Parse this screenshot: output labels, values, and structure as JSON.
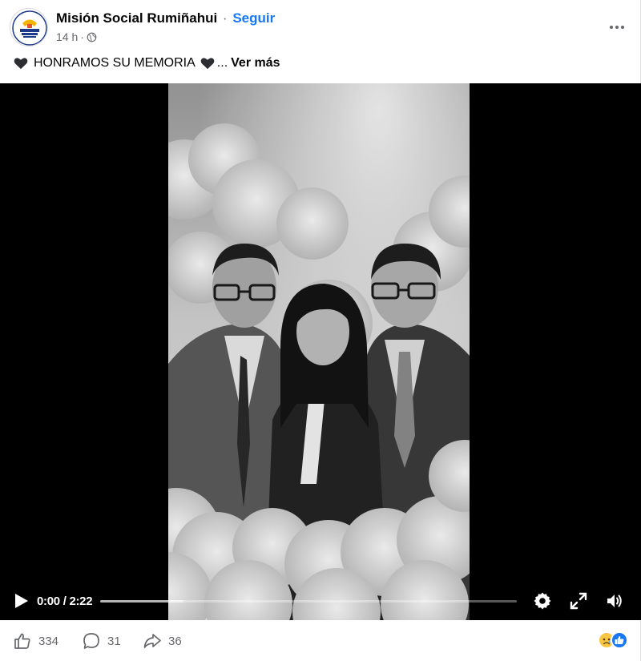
{
  "post": {
    "page_name": "Misión Social Rumiñahui",
    "separator": "·",
    "follow_label": "Seguir",
    "time_ago": "14 h",
    "meta_separator": "·",
    "audience_icon": "globe-icon",
    "caption_text": "HONRAMOS SU MEMORIA",
    "caption_emoji": "black-heart",
    "caption_ellipsis": "...",
    "see_more_label": "Ver más"
  },
  "video": {
    "current_time": "0:00",
    "duration": "2:22",
    "time_separator": " / ",
    "progress": 0.2,
    "controls": [
      "play-icon",
      "settings-icon",
      "fullscreen-icon",
      "volume-icon"
    ]
  },
  "footer": {
    "likes": "334",
    "comments": "31",
    "shares": "36",
    "reaction_icons": [
      "sad-reaction-icon",
      "like-reaction-icon"
    ]
  },
  "colors": {
    "accent": "#1877f2",
    "muted": "#65676b",
    "text": "#050505"
  }
}
